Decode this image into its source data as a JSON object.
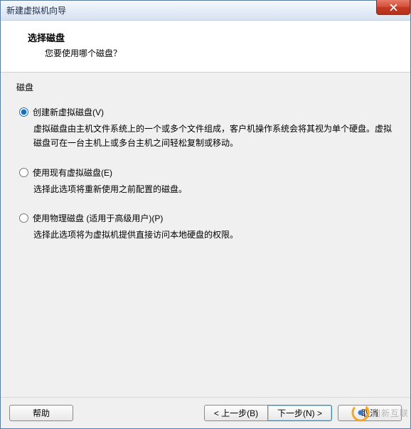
{
  "window": {
    "title": "新建虚拟机向导"
  },
  "header": {
    "title": "选择磁盘",
    "subtitle": "您要使用哪个磁盘？"
  },
  "section_label": "磁盘",
  "options": {
    "create": {
      "label": "创建新虚拟磁盘(V)",
      "desc": "虚拟磁盘由主机文件系统上的一个或多个文件组成，客户机操作系统会将其视为单个硬盘。虚拟磁盘可在一台主机上或多台主机之间轻松复制或移动。"
    },
    "existing": {
      "label": "使用现有虚拟磁盘(E)",
      "desc": "选择此选项将重新使用之前配置的磁盘。"
    },
    "physical": {
      "label": "使用物理磁盘 (适用于高级用户)(P)",
      "desc": "选择此选项将为虚拟机提供直接访问本地硬盘的权限。"
    }
  },
  "buttons": {
    "help": "帮助",
    "back": "< 上一步(B)",
    "next": "下一步(N) >",
    "cancel": "取消"
  },
  "watermark": "创新互联"
}
